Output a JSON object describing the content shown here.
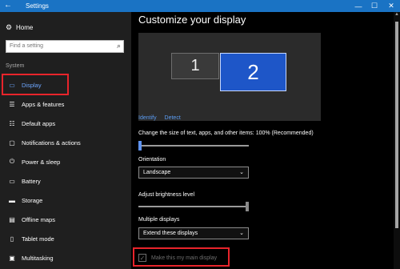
{
  "window": {
    "title": "Settings",
    "back_icon": "←",
    "minimize": "—",
    "maximize": "☐",
    "close": "✕"
  },
  "sidebar": {
    "home": "Home",
    "search_placeholder": "Find a setting",
    "section_label": "System",
    "items": [
      {
        "label": "Display",
        "icon": "display-icon",
        "glyph": "▭",
        "active": true
      },
      {
        "label": "Apps & features",
        "icon": "apps-icon",
        "glyph": "☰",
        "active": false
      },
      {
        "label": "Default apps",
        "icon": "default-apps-icon",
        "glyph": "☷",
        "active": false
      },
      {
        "label": "Notifications & actions",
        "icon": "notifications-icon",
        "glyph": "▢",
        "active": false
      },
      {
        "label": "Power & sleep",
        "icon": "power-icon",
        "glyph": "⏻",
        "active": false
      },
      {
        "label": "Battery",
        "icon": "battery-icon",
        "glyph": "▭",
        "active": false
      },
      {
        "label": "Storage",
        "icon": "storage-icon",
        "glyph": "▬",
        "active": false
      },
      {
        "label": "Offline maps",
        "icon": "map-icon",
        "glyph": "▤",
        "active": false
      },
      {
        "label": "Tablet mode",
        "icon": "tablet-icon",
        "glyph": "▯",
        "active": false
      },
      {
        "label": "Multitasking",
        "icon": "multitasking-icon",
        "glyph": "▣",
        "active": false
      }
    ]
  },
  "main": {
    "title": "Customize your display",
    "monitors": [
      "1",
      "2"
    ],
    "identify": "Identify",
    "detect": "Detect",
    "scale_label": "Change the size of text, apps, and other items: 100% (Recommended)",
    "scale_level": 0,
    "orientation_label": "Orientation",
    "orientation_value": "Landscape",
    "brightness_label": "Adjust brightness level",
    "brightness_level": 1.0,
    "multiple_label": "Multiple displays",
    "multiple_value": "Extend these displays",
    "main_display_label": "Make this my main display"
  },
  "colors": {
    "titlebar": "#1a73c4",
    "accent": "#5f93f0",
    "highlight": "#e8242b"
  }
}
